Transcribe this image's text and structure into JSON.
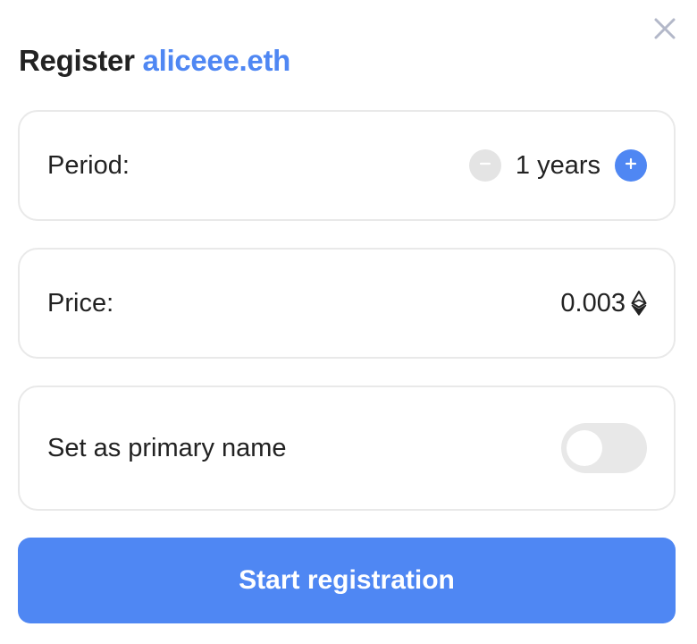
{
  "dialog": {
    "title_prefix": "Register",
    "domain_name": "aliceee.eth",
    "close_icon": "close-icon"
  },
  "period": {
    "label": "Period:",
    "value": "1 years",
    "decrement_icon": "minus-circle-icon",
    "increment_icon": "plus-circle-icon"
  },
  "price": {
    "label": "Price:",
    "value": "0.003",
    "currency_icon": "ethereum-icon"
  },
  "primary_name": {
    "label": "Set as primary name",
    "enabled": false
  },
  "actions": {
    "submit_label": "Start registration"
  },
  "colors": {
    "accent": "#4f87f3",
    "text": "#222222",
    "border": "#e9e9e9",
    "toggle_off": "#e8e8e8"
  }
}
